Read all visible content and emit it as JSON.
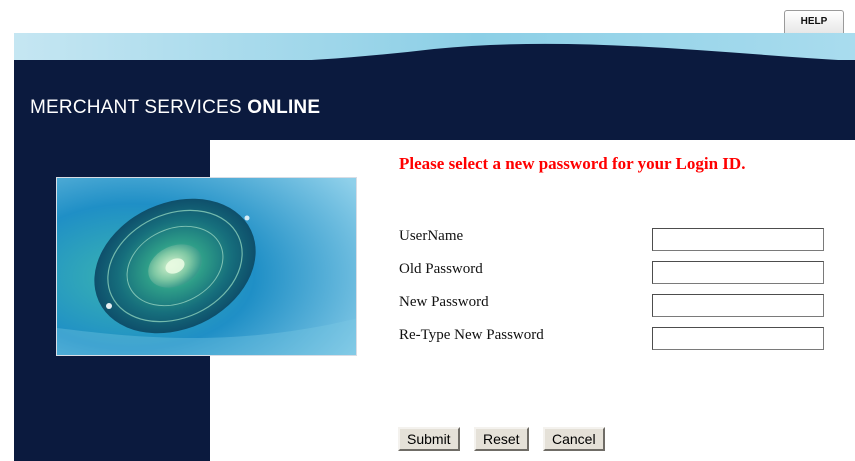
{
  "help": {
    "label": "HELP"
  },
  "brand": {
    "prefix": "MERCHANT SERVICES ",
    "bold": "ONLINE"
  },
  "form": {
    "title": "Please select a new password for your Login ID.",
    "fields": [
      {
        "label": "UserName",
        "value": ""
      },
      {
        "label": "Old Password",
        "value": ""
      },
      {
        "label": "New Password",
        "value": ""
      },
      {
        "label": "Re-Type New Password",
        "value": ""
      }
    ],
    "buttons": {
      "submit": "Submit",
      "reset": "Reset",
      "cancel": "Cancel"
    }
  },
  "colors": {
    "navy": "#0b1a3e",
    "sky": "#9fd4ea",
    "title_red": "#ff0000",
    "button_face": "#e5e1d8"
  }
}
